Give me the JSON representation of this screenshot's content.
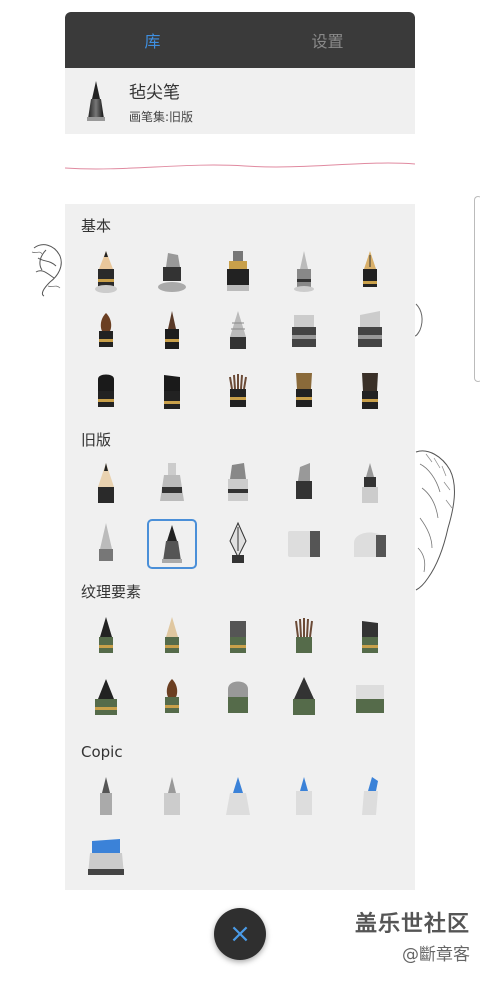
{
  "tabs": [
    {
      "label": "库",
      "active": true
    },
    {
      "label": "设置",
      "active": false
    }
  ],
  "current_brush": {
    "name": "毡尖笔",
    "set": "画笔集:旧版"
  },
  "sections": [
    {
      "title": "基本"
    },
    {
      "title": "旧版"
    },
    {
      "title": "纹理要素"
    },
    {
      "title": "Copic"
    }
  ],
  "close_icon": "×",
  "watermark": {
    "main": "盖乐世社区",
    "sub": "@斷章客"
  },
  "colors": {
    "accent": "#3f8fe0",
    "tabbar": "#3a3a3a",
    "panel": "#f0f0f0"
  }
}
